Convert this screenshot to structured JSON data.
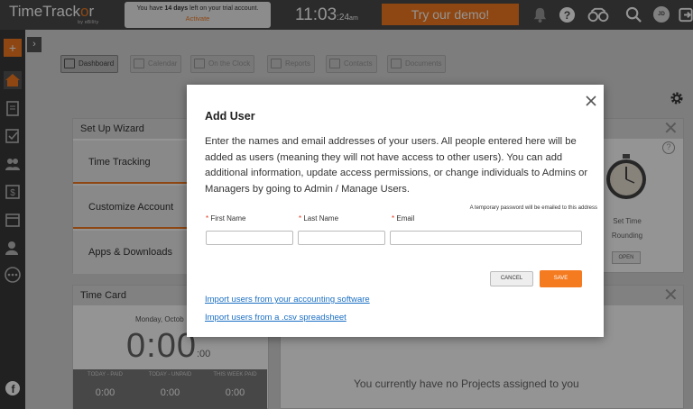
{
  "header": {
    "logo_pre": "TimeTrack",
    "logo_o": "o",
    "logo_post": "r",
    "logo_sub": "by eBility",
    "trial_pre": "You have ",
    "trial_days": "14 days",
    "trial_post": " left on your trial account.",
    "trial_link": "Activate",
    "time_hm": "11:03",
    "time_s": ":24",
    "time_ampm": "am",
    "demo_label": "Try our demo!",
    "avatar_initials": "JD"
  },
  "sidebar": {
    "add_label": "+",
    "expand_label": "›"
  },
  "nav": {
    "items": [
      {
        "label": "Dashboard"
      },
      {
        "label": "Calendar"
      },
      {
        "label": "On the Clock"
      },
      {
        "label": "Reports"
      },
      {
        "label": "Contacts"
      },
      {
        "label": "Documents"
      }
    ]
  },
  "wizard": {
    "title": "Set Up Wizard",
    "items": [
      "Time Tracking",
      "Customize Account",
      "Apps & Downloads"
    ]
  },
  "timecard": {
    "title": "Time Card",
    "date": "Monday, Octob",
    "time": "0:00",
    "time_small": ":00",
    "cols": [
      {
        "label": "TODAY - PAID",
        "value": "0:00"
      },
      {
        "label": "TODAY - UNPAID",
        "value": "0:00"
      },
      {
        "label": "THIS WEEK PAID",
        "value": "0:00"
      }
    ]
  },
  "rounding": {
    "label1": "Set Time",
    "label2": "Rounding",
    "open_label": "OPEN"
  },
  "projects": {
    "empty_text": "You currently have no Projects assigned to you"
  },
  "modal": {
    "title": "Add User",
    "description": "Enter the names and email addresses of your users. All people entered here will be added as users (meaning they will not have access to other users). You can add additional information, update access permissions, or change individuals to Admins or Managers by going to Admin / Manage Users.",
    "password_note": "A temporary password will be emailed to this address",
    "first_name_label": "First Name",
    "last_name_label": "Last Name",
    "email_label": "Email",
    "required_mark": "*",
    "first_name_value": "",
    "last_name_value": "",
    "email_value": "",
    "cancel_label": "CANCEL",
    "save_label": "SAVE",
    "link_accounting": "Import users from your accounting software",
    "link_csv": "Import users from a .csv spreadsheet"
  },
  "colors": {
    "accent": "#f47b20",
    "topbar": "#4a4a4a",
    "link": "#1a6fc4"
  }
}
